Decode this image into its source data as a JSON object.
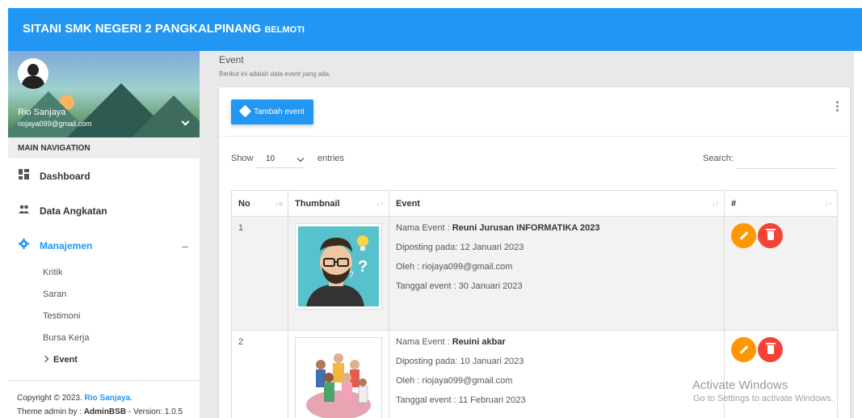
{
  "app": {
    "title": "SITANI SMK NEGERI 2 PANGKALPINANG",
    "subtitle": "BELMOTI"
  },
  "user": {
    "name": "Rio Sanjaya",
    "email": "riojaya099@gmail.com"
  },
  "sidebar": {
    "header": "MAIN NAVIGATION",
    "items": [
      {
        "label": "Dashboard",
        "icon": "dashboard-icon"
      },
      {
        "label": "Data Angkatan",
        "icon": "people-icon"
      },
      {
        "label": "Manajemen",
        "icon": "gear-icon",
        "expanded": true
      }
    ],
    "sub_items": [
      "Kritik",
      "Saran",
      "Testimoni",
      "Bursa Kerja",
      "Event"
    ],
    "footer": {
      "copyright": "Copyright © 2023.",
      "author": "Rio Sanjaya",
      "theme_prefix": "Theme admin by :",
      "theme": "AdminBSB",
      "version": "- Version: 1.0.5"
    }
  },
  "page": {
    "title": "Event",
    "subtitle": "Berikut ini adalah data event yang ada."
  },
  "toolbar": {
    "add_label": "Tambah event"
  },
  "table_controls": {
    "show_label": "Show",
    "entries_value": "10",
    "entries_label": "entries",
    "search_label": "Search:"
  },
  "table": {
    "headers": [
      "No",
      "Thumbnail",
      "Event",
      "#"
    ],
    "rows": [
      {
        "no": "1",
        "name_label": "Nama Event :",
        "name": "Reuni Jurusan INFORMATIKA 2023",
        "posted": "Diposting pada: 12 Januari 2023",
        "by": "Oleh : riojaya099@gmail.com",
        "date": "Tanggal event : 30 Januari 2023"
      },
      {
        "no": "2",
        "name_label": "Nama Event :",
        "name": "Reuini akbar",
        "posted": "Diposting pada: 10 Januari 2023",
        "by": "Oleh : riojaya099@gmail.com",
        "date": "Tanggal event : 11 Februari 2023"
      }
    ]
  },
  "watermark": {
    "line1": "Activate Windows",
    "line2": "Go to Settings to activate Windows."
  },
  "colors": {
    "primary": "#2196f3",
    "edit": "#ff9800",
    "delete": "#f44336"
  }
}
